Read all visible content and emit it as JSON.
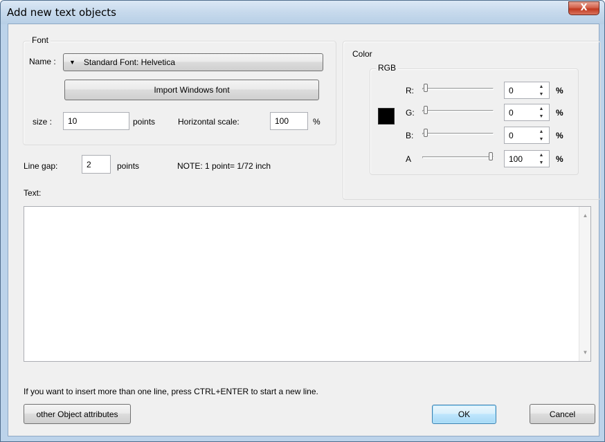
{
  "window": {
    "title": "Add new text objects",
    "close_glyph": "X"
  },
  "font_group": {
    "label": "Font",
    "name_label": "Name :",
    "font_dropdown_value": "Standard Font: Helvetica",
    "import_button_label": "Import Windows font",
    "size_label": "size :",
    "size_value": "10",
    "size_unit": "points",
    "hscale_label": "Horizontal scale:",
    "hscale_value": "100",
    "hscale_unit": "%"
  },
  "line_gap": {
    "label": "Line gap:",
    "value": "2",
    "unit": "points",
    "note": "NOTE: 1 point= 1/72 inch"
  },
  "color_group": {
    "label": "Color",
    "rgb_label": "RGB",
    "swatch_color": "#000000",
    "channels": [
      {
        "label": "R:",
        "value": "0",
        "unit": "%",
        "level": 0
      },
      {
        "label": "G:",
        "value": "0",
        "unit": "%",
        "level": 0
      },
      {
        "label": "B:",
        "value": "0",
        "unit": "%",
        "level": 0
      },
      {
        "label": "A",
        "value": "100",
        "unit": "%",
        "level": 1
      }
    ]
  },
  "text_section": {
    "label": "Text:",
    "value": ""
  },
  "hint": "If you want to insert more than one line, press CTRL+ENTER to start a new line.",
  "buttons": {
    "other_attributes": "other Object attributes",
    "ok": "OK",
    "cancel": "Cancel"
  }
}
